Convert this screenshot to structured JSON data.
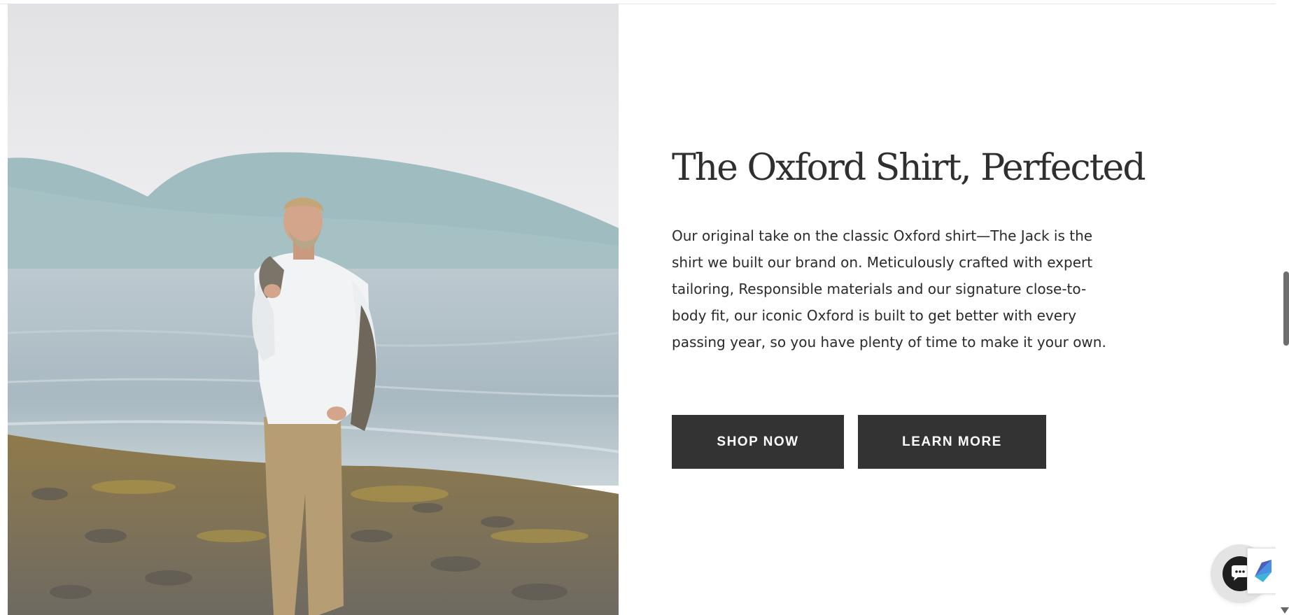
{
  "hero": {
    "image_alt": "Man in white Oxford shirt and khaki pants standing on a rocky shoreline by the water"
  },
  "content": {
    "headline": "The Oxford Shirt, Perfected",
    "description": "Our original take on the classic Oxford shirt—The Jack is the shirt we built our brand on. Meticulously crafted with expert tailoring, Responsible materials and our signature close-to-body fit, our iconic Oxford is built to get better with every passing year, so you have plenty of time to make it your own.",
    "shop_now_label": "SHOP NOW",
    "learn_more_label": "LEARN MORE"
  },
  "widgets": {
    "chat_icon": "chat-bubble-icon",
    "recaptcha_icon": "recaptcha-icon"
  },
  "colors": {
    "button_bg": "#333333",
    "button_text": "#ffffff",
    "headline": "#2f2f2f",
    "body_text": "#2a2a2a"
  }
}
